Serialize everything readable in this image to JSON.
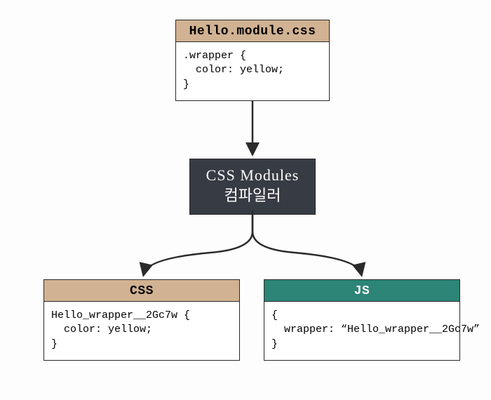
{
  "source_box": {
    "title": "Hello.module.css",
    "code": ".wrapper {\n  color: yellow;\n}"
  },
  "compiler_box": {
    "line1": "CSS Modules",
    "line2": "컴파일러"
  },
  "css_box": {
    "title": "CSS",
    "code": "Hello_wrapper__2Gc7w {\n  color: yellow;\n}"
  },
  "js_box": {
    "title": "JS",
    "code": "{\n  wrapper: “Hello_wrapper__2Gc7w”\n}"
  },
  "colors": {
    "tan": "#d1b292",
    "teal": "#2c8576",
    "dark": "#373b43",
    "border": "#2a2a2a"
  }
}
